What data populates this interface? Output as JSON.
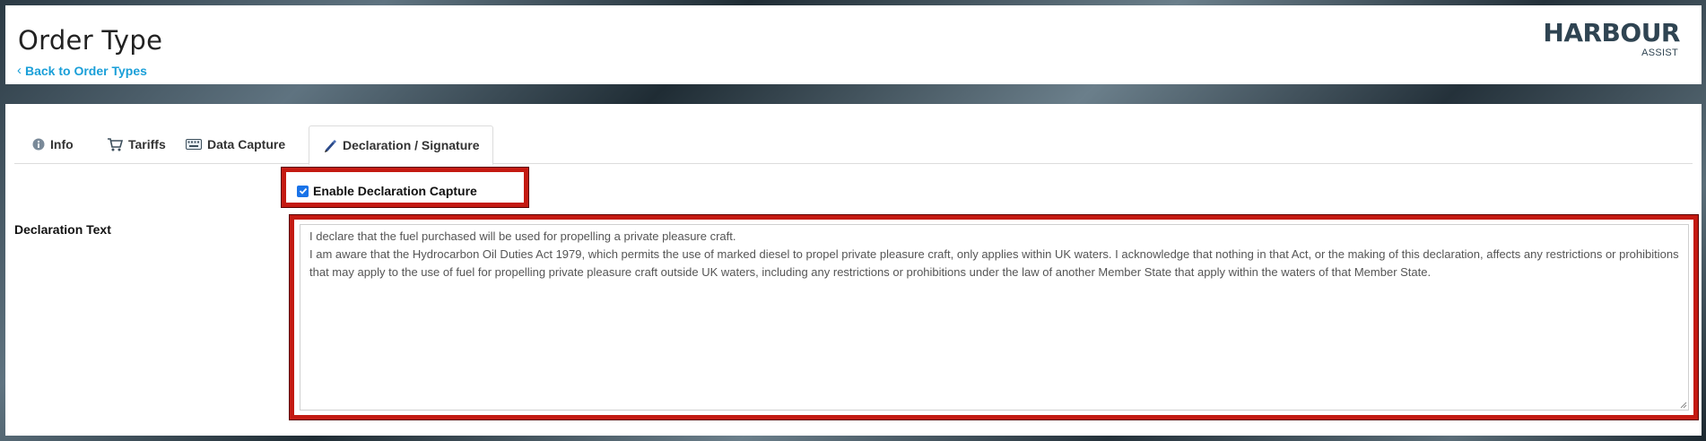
{
  "header": {
    "title": "Order Type",
    "back_label": "Back to Order Types",
    "logo_text": "HARBOUR",
    "logo_sub": "ASSIST"
  },
  "tabs": [
    {
      "label": "Info",
      "icon": "info-icon"
    },
    {
      "label": "Tariffs",
      "icon": "cart-icon"
    },
    {
      "label": "Data Capture",
      "icon": "keyboard-icon"
    },
    {
      "label": "Declaration / Signature",
      "icon": "pen-icon",
      "active": true
    }
  ],
  "form": {
    "enable_label": "Enable Declaration Capture",
    "enable_checked": true,
    "declaration_label": "Declaration Text",
    "declaration_lines": [
      "I declare that the fuel purchased will be used for propelling a private pleasure craft.",
      "I am aware that the Hydrocarbon Oil Duties Act 1979, which permits the use of marked diesel to propel private pleasure craft, only applies within UK waters. I acknowledge that nothing in that Act, or the making of this declaration, affects any restrictions or prohibitions that may apply to the use of fuel for propelling private pleasure craft outside UK waters, including any restrictions or prohibitions under the law of another Member State that apply within the waters of that Member State."
    ]
  },
  "colors": {
    "accent_link": "#1a9fd8",
    "highlight_border": "#c41a12",
    "logo": "#2f4452"
  }
}
